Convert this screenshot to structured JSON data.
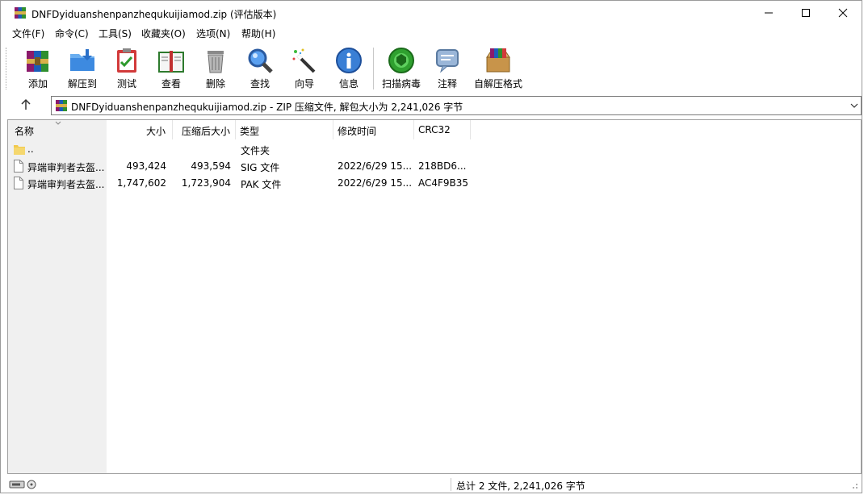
{
  "window": {
    "title": "DNFDyiduanshenpanzhequkuijiamod.zip (评估版本)",
    "controls": {
      "minimize": "─",
      "maximize": "☐",
      "close": "✕"
    }
  },
  "menu": [
    "文件(F)",
    "命令(C)",
    "工具(S)",
    "收藏夹(O)",
    "选项(N)",
    "帮助(H)"
  ],
  "toolbar": {
    "add": "添加",
    "extract": "解压到",
    "test": "测试",
    "view": "查看",
    "delete": "删除",
    "find": "查找",
    "wizard": "向导",
    "info": "信息",
    "scan": "扫描病毒",
    "comment": "注释",
    "sfx": "自解压格式"
  },
  "address": {
    "text": "DNFDyiduanshenpanzhequkuijiamod.zip - ZIP 压缩文件, 解包大小为 2,241,026 字节"
  },
  "columns": {
    "name": "名称",
    "size": "大小",
    "packed": "压缩后大小",
    "type": "类型",
    "modified": "修改时间",
    "crc": "CRC32"
  },
  "rows": [
    {
      "name": "..",
      "size": "",
      "packed": "",
      "type": "文件夹",
      "modified": "",
      "crc": "",
      "icon": "folder-icon"
    },
    {
      "name": "异端审判者去盔...",
      "size": "493,424",
      "packed": "493,594",
      "type": "SIG 文件",
      "modified": "2022/6/29 15...",
      "crc": "218BD6...",
      "icon": "file-icon"
    },
    {
      "name": "异端审判者去盔...",
      "size": "1,747,602",
      "packed": "1,723,904",
      "type": "PAK 文件",
      "modified": "2022/6/29 15...",
      "crc": "AC4F9B35",
      "icon": "file-icon"
    }
  ],
  "status": {
    "summary": "总计 2 文件, 2,241,026 字节"
  }
}
